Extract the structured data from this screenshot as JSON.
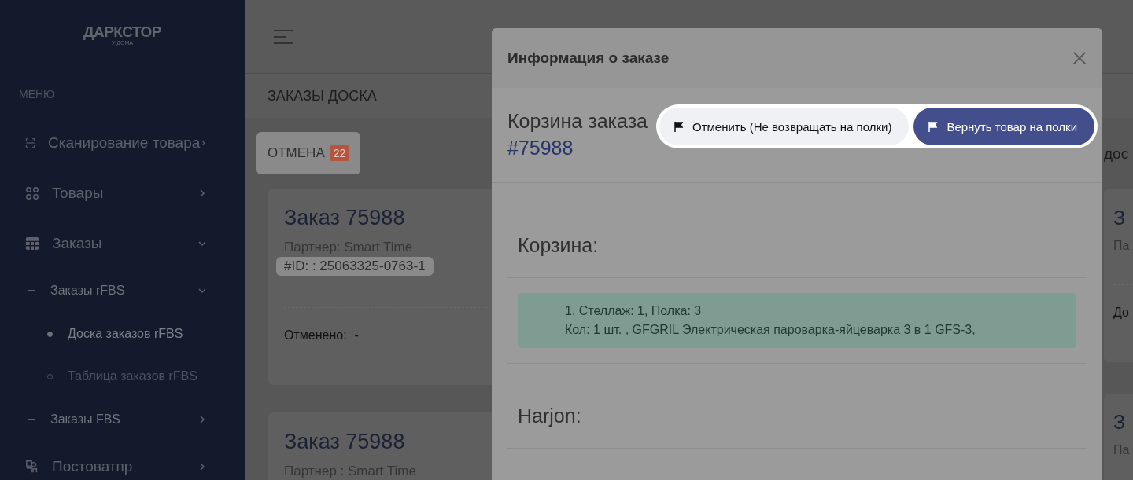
{
  "sidebar": {
    "logo": "ДАРКСТОР",
    "logo_sub": "У ДОМА",
    "menu_label": "МЕНЮ",
    "items": [
      {
        "label": "Сканирование товара",
        "kind": "scan",
        "expanded": false
      },
      {
        "label": "Товары",
        "kind": "grid",
        "expanded": false
      },
      {
        "label": "Заказы",
        "kind": "table",
        "expanded": true,
        "children": [
          {
            "label": "Заказы rFBS",
            "expanded": true,
            "children": [
              {
                "label": "Доска заказов rFBS",
                "selected": true
              },
              {
                "label": "Таблица заказов rFBS",
                "selected": false
              }
            ]
          },
          {
            "label": "Заказы FBS",
            "expanded": false
          }
        ]
      },
      {
        "label": "Постоватпр",
        "kind": "supplier",
        "expanded": false
      }
    ]
  },
  "page": {
    "title": "ЗАКАЗЫ ДОСКА"
  },
  "board": {
    "column": {
      "title": "ОТМЕНА",
      "count": "22",
      "cards": [
        {
          "title": "Заказ 75988",
          "partner": "Партнер: Smart Time",
          "id": "#ID: : 25063325-0763-1",
          "footer_label": "Отменено:",
          "footer_value": "-"
        },
        {
          "title": "Заказ 75988",
          "partner": "Партнер : Smart Time"
        }
      ]
    },
    "next_column": {
      "title": "дос",
      "cards": [
        {
          "title": "З",
          "partner": "Па",
          "footer_label": "До"
        },
        {
          "title": "З",
          "partner": "Па"
        }
      ]
    }
  },
  "modal": {
    "title": "Информация о заказе",
    "heading": "Корзина заказа",
    "order": "#75988",
    "actions": [
      {
        "label": "Отменить (Не возвращать на полки)",
        "kind": "secondary"
      },
      {
        "label": "Вернуть товар на полки",
        "kind": "primary"
      }
    ],
    "sections": [
      {
        "title": "Корзина:",
        "lines": [
          "1. Стеллаж: 1, Полка: 3",
          "Кол: 1 шт. , GFGRIL Электрическая пароварка-яйцеварка 3 в 1 GFS-3,"
        ]
      },
      {
        "title": "Нarjon:"
      }
    ]
  }
}
